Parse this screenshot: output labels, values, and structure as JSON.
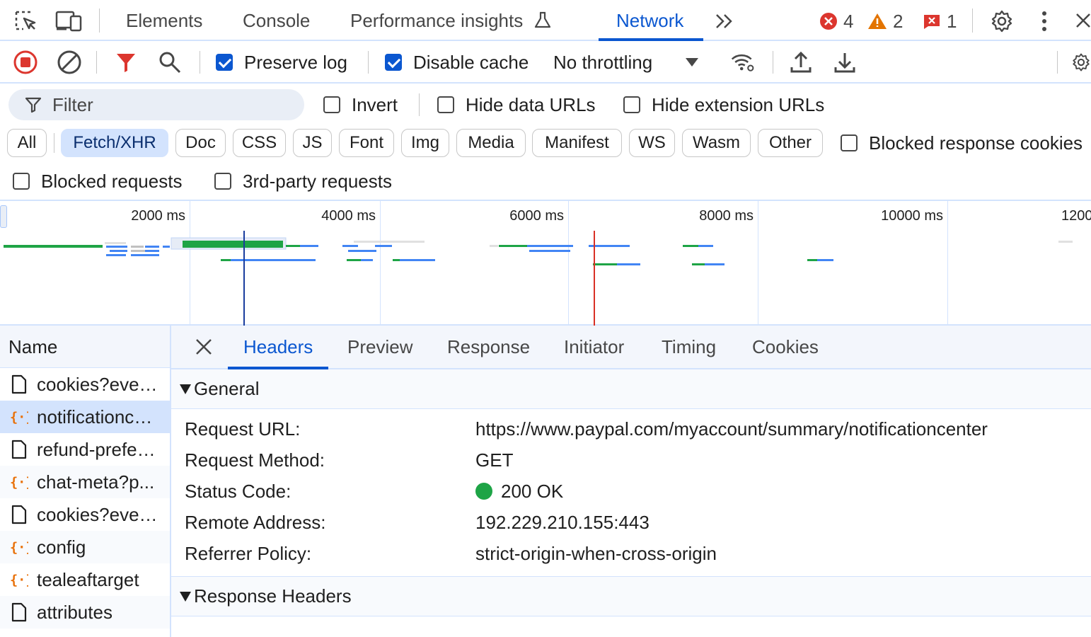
{
  "topbar": {
    "tabs": [
      {
        "label": "Elements"
      },
      {
        "label": "Console"
      },
      {
        "label": "Performance insights"
      },
      {
        "label": "Network"
      }
    ],
    "counters": {
      "errors": "4",
      "warnings": "2",
      "issues": "1"
    }
  },
  "toolbar": {
    "preserve_log": "Preserve log",
    "disable_cache": "Disable cache",
    "throttling": "No throttling"
  },
  "filters": {
    "placeholder": "Filter",
    "invert": "Invert",
    "hide_data_urls": "Hide data URLs",
    "hide_extension_urls": "Hide extension URLs",
    "types": [
      "All",
      "Fetch/XHR",
      "Doc",
      "CSS",
      "JS",
      "Font",
      "Img",
      "Media",
      "Manifest",
      "WS",
      "Wasm",
      "Other"
    ],
    "active_type": "Fetch/XHR",
    "blocked_response_cookies": "Blocked response cookies",
    "blocked_requests": "Blocked requests",
    "third_party": "3rd-party requests"
  },
  "timeline": {
    "ticks": [
      "2000 ms",
      "4000 ms",
      "6000 ms",
      "8000 ms",
      "10000 ms",
      "1200"
    ]
  },
  "requests": {
    "header": "Name",
    "rows": [
      {
        "name": "cookies?eventType=...",
        "type": "doc"
      },
      {
        "name": "notificationcenter",
        "type": "xhr"
      },
      {
        "name": "refund-preferences",
        "type": "doc"
      },
      {
        "name": "chat-meta?p...",
        "type": "xhr"
      },
      {
        "name": "cookies?eventType=...",
        "type": "doc"
      },
      {
        "name": "config",
        "type": "xhr"
      },
      {
        "name": "tealeaftarget",
        "type": "xhr"
      },
      {
        "name": "attributes",
        "type": "doc"
      }
    ]
  },
  "detail": {
    "tabs": [
      "Headers",
      "Preview",
      "Response",
      "Initiator",
      "Timing",
      "Cookies"
    ],
    "general": {
      "title": "General",
      "request_url_label": "Request URL:",
      "request_url": "https://www.paypal.com/myaccount/summary/notificationcenter",
      "method_label": "Request Method:",
      "method": "GET",
      "status_label": "Status Code:",
      "status": "200 OK",
      "remote_label": "Remote Address:",
      "remote": "192.229.210.155:443",
      "referrer_label": "Referrer Policy:",
      "referrer": "strict-origin-when-cross-origin"
    },
    "response_headers_title": "Response Headers"
  },
  "colors": {
    "accent": "#0b57d0",
    "error": "#dc362e",
    "warning": "#e37400",
    "ok": "#1ea446"
  }
}
